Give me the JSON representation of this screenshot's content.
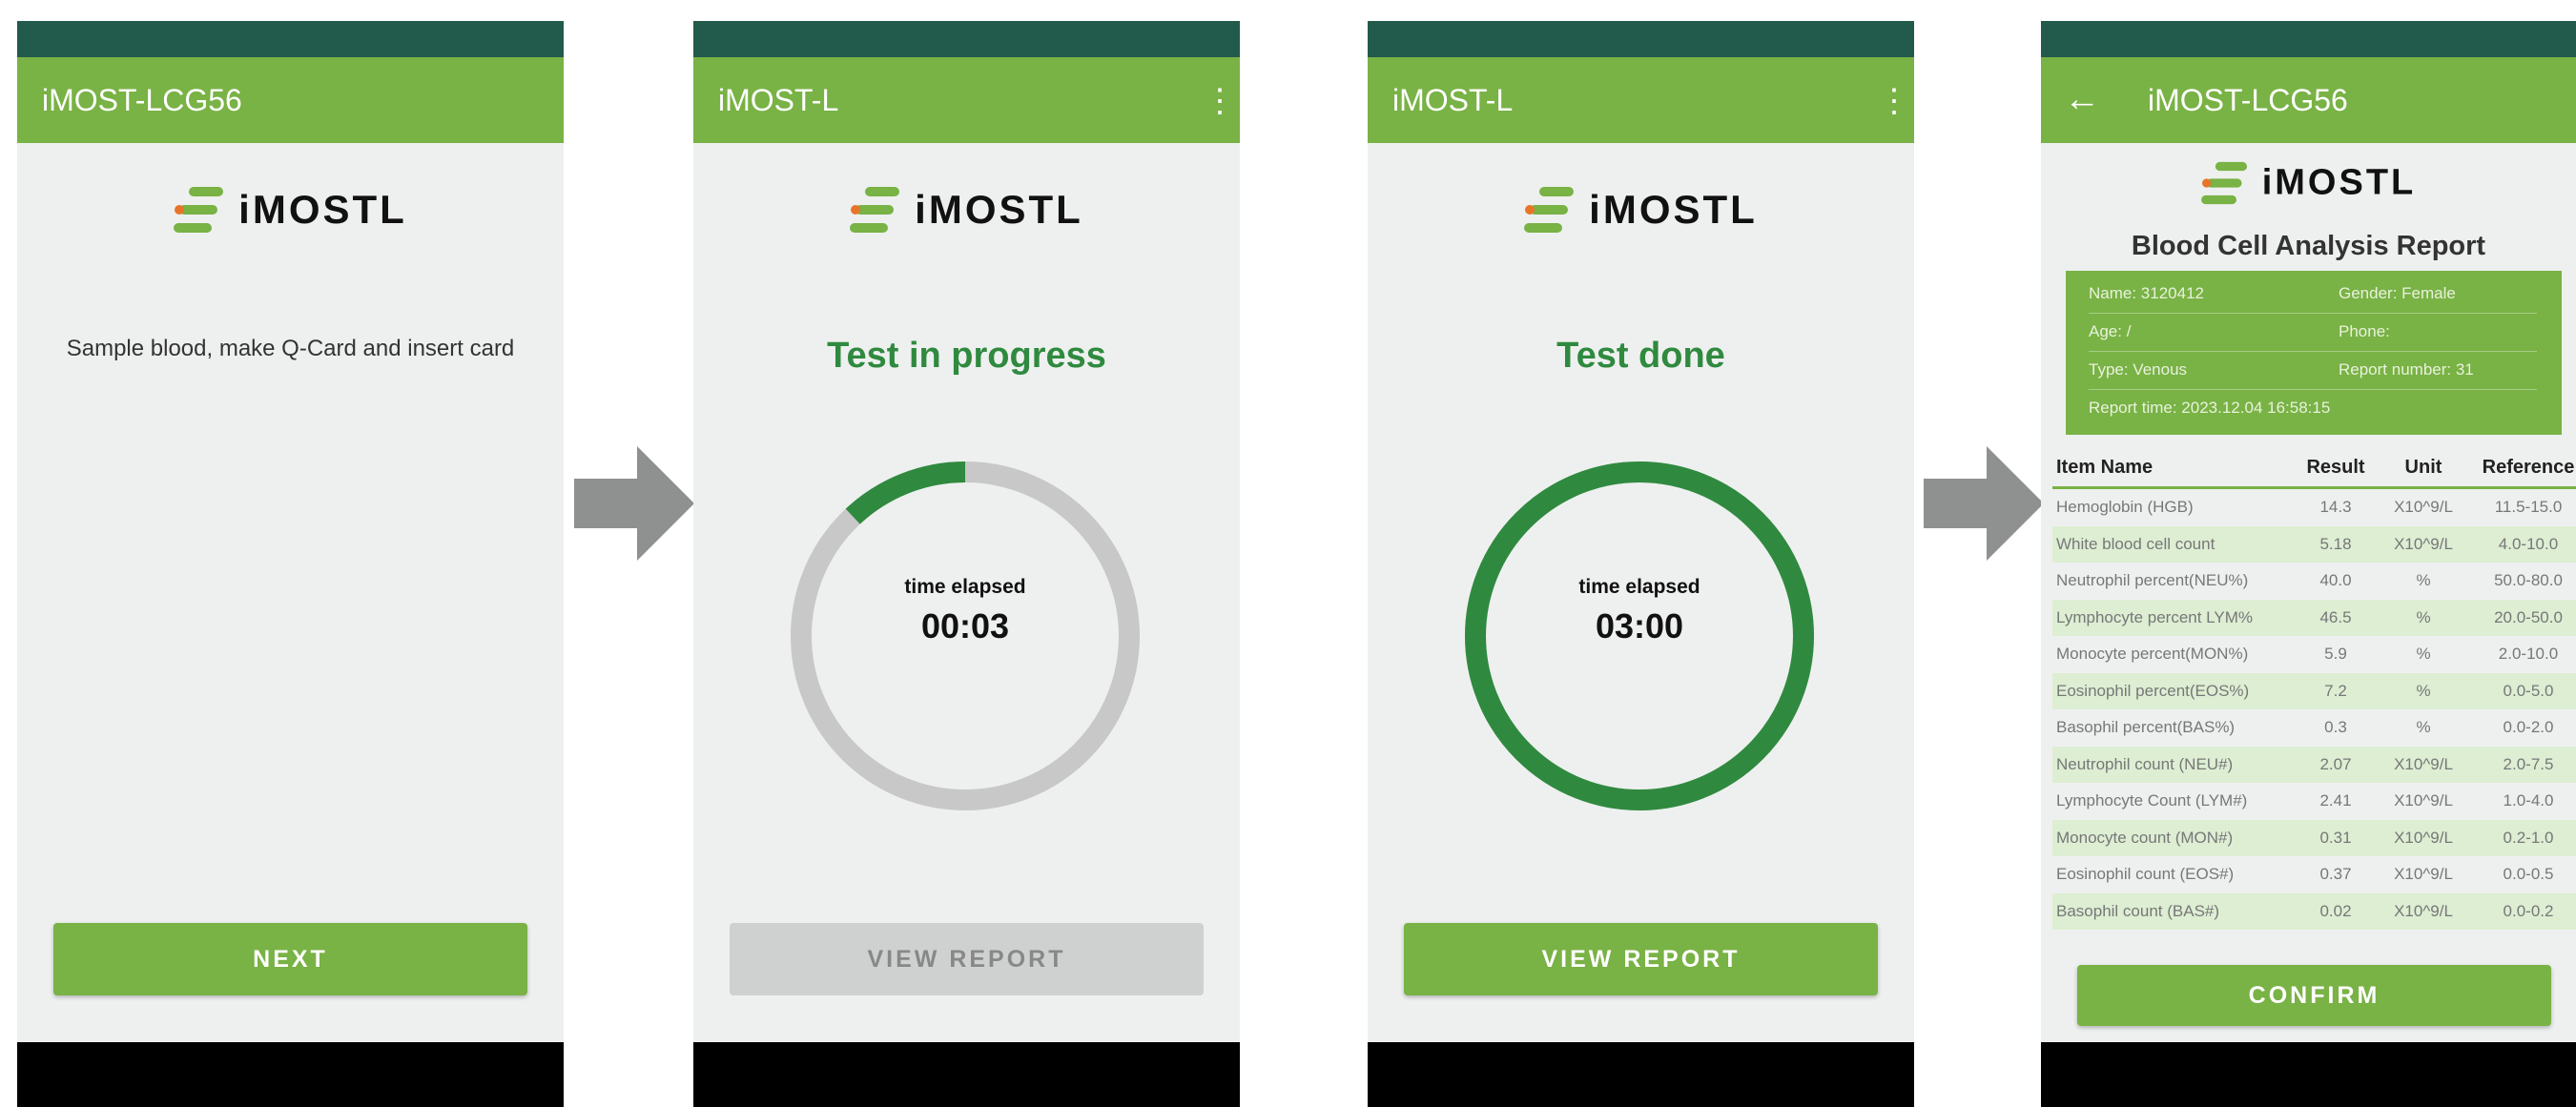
{
  "colors": {
    "status_bar": "#225a4c",
    "app_bar": "#79b245",
    "accent_green": "#2f8a3f",
    "progress_track": "#c7c8c7",
    "button_disabled": "#cfd1d0"
  },
  "brand": {
    "logo_icon": "imost-logo-icon",
    "logo_text": "iMOSTL"
  },
  "screen1": {
    "app_title": "iMOST-LCG56",
    "instruction": "Sample blood, make Q-Card and insert card",
    "next_label": "NEXT"
  },
  "screen2": {
    "app_title": "iMOST-L",
    "menu_icon": "more-vert-icon",
    "status": "Test in progress",
    "elapsed_label": "time elapsed",
    "elapsed_value": "00:03",
    "progress_fraction": 0.12,
    "view_report_label": "VIEW REPORT",
    "view_report_enabled": false
  },
  "screen3": {
    "app_title": "iMOST-L",
    "menu_icon": "more-vert-icon",
    "status": "Test done",
    "elapsed_label": "time elapsed",
    "elapsed_value": "03:00",
    "progress_fraction": 1.0,
    "view_report_label": "VIEW REPORT",
    "view_report_enabled": true
  },
  "screen4": {
    "app_title": "iMOST-LCG56",
    "back_icon": "arrow-back-icon",
    "report_title": "Blood Cell Analysis Report",
    "patient": {
      "name": "Name: 3120412",
      "gender": "Gender: Female",
      "age": "Age: /",
      "phone": "Phone:",
      "type": "Type: Venous",
      "report_number": "Report number: 31",
      "report_time": "Report time: 2023.12.04 16:58:15"
    },
    "columns": [
      "Item Name",
      "Result",
      "Unit",
      "Reference"
    ],
    "rows": [
      [
        "Hemoglobin (HGB)",
        "14.3",
        "X10^9/L",
        "11.5-15.0"
      ],
      [
        "White blood cell count",
        "5.18",
        "X10^9/L",
        "4.0-10.0"
      ],
      [
        "Neutrophil percent(NEU%)",
        "40.0",
        "%",
        "50.0-80.0"
      ],
      [
        "Lymphocyte percent LYM%",
        "46.5",
        "%",
        "20.0-50.0"
      ],
      [
        "Monocyte percent(MON%)",
        "5.9",
        "%",
        "2.0-10.0"
      ],
      [
        "Eosinophil percent(EOS%)",
        "7.2",
        "%",
        "0.0-5.0"
      ],
      [
        "Basophil percent(BAS%)",
        "0.3",
        "%",
        "0.0-2.0"
      ],
      [
        "Neutrophil count (NEU#)",
        "2.07",
        "X10^9/L",
        "2.0-7.5"
      ],
      [
        "Lymphocyte Count (LYM#)",
        "2.41",
        "X10^9/L",
        "1.0-4.0"
      ],
      [
        "Monocyte count (MON#)",
        "0.31",
        "X10^9/L",
        "0.2-1.0"
      ],
      [
        "Eosinophil count (EOS#)",
        "0.37",
        "X10^9/L",
        "0.0-0.5"
      ],
      [
        "Basophil count (BAS#)",
        "0.02",
        "X10^9/L",
        "0.0-0.2"
      ]
    ],
    "confirm_label": "CONFIRM"
  }
}
